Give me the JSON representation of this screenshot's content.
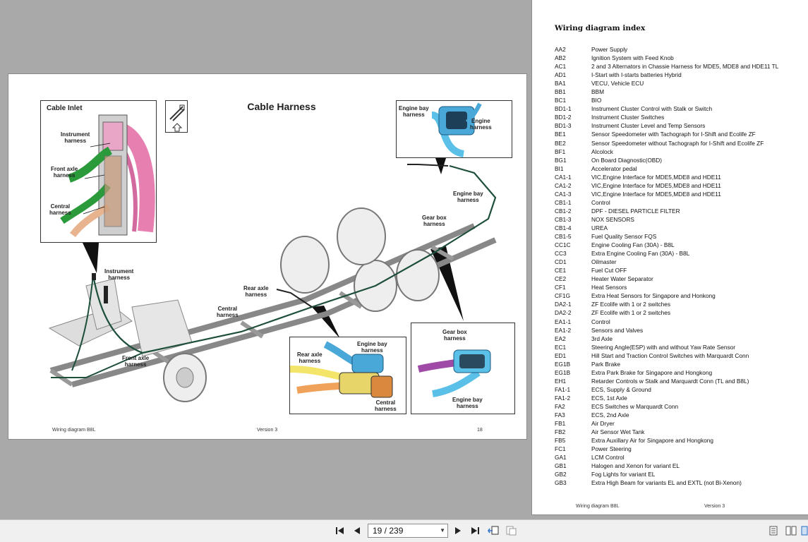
{
  "left_page": {
    "title": "Cable Harness",
    "inset_cable_inlet": "Cable Inlet",
    "labels": {
      "instrument_harness_inset": "Instrument\nharness",
      "front_axle_harness_inset": "Front axle\nharness",
      "central_harness_inset": "Central\nharness",
      "engine_bay_harness_top": "Engine bay\nharness",
      "engine_harness_top": "Engine\nharness",
      "engine_bay_harness_mid": "Engine bay\nharness",
      "gear_box_harness_mid": "Gear box\nharness",
      "instrument_harness_main": "Instrument\nharness",
      "rear_axle_harness_main": "Rear axle\nharness",
      "central_harness_main": "Central\nharness",
      "front_axle_harness_main": "Front axle\nharness",
      "engine_bay_harness_inset2": "Engine bay\nharness",
      "rear_axle_harness_inset2": "Rear axle\nharness",
      "central_harness_inset2": "Central\nharness",
      "gear_box_harness_inset3": "Gear box\nharness",
      "engine_bay_harness_inset3": "Engine bay\nharness"
    },
    "footer_left": "Wiring diagram B8L",
    "footer_center": "Version 3",
    "footer_page": "18"
  },
  "right_page": {
    "title": "Wiring diagram index",
    "rows": [
      {
        "code": "AA2",
        "desc": "Power Supply"
      },
      {
        "code": "AB2",
        "desc": "Ignition System with Feed Knob"
      },
      {
        "code": "AC1",
        "desc": "2 and 3 Alternators in Chassie Harness for MDE5, MDE8 and HDE11 TL"
      },
      {
        "code": "AD1",
        "desc": "I-Start with I-starts batteries Hybrid"
      },
      {
        "code": "BA1",
        "desc": "VECU, Vehicle ECU"
      },
      {
        "code": "BB1",
        "desc": "BBM"
      },
      {
        "code": "BC1",
        "desc": "BIO"
      },
      {
        "code": "BD1-1",
        "desc": "Instrument Cluster Control with Stalk or Switch"
      },
      {
        "code": "BD1-2",
        "desc": "Instrument Cluster Switches"
      },
      {
        "code": "BD1-3",
        "desc": "Instrument Cluster Level and Temp Sensors"
      },
      {
        "code": "BE1",
        "desc": "Sensor Speedometer with Tachograph for I-Shift and Ecolife ZF"
      },
      {
        "code": "BE2",
        "desc": "Sensor Speedometer without Tachograph for I-Shift and Ecolife ZF"
      },
      {
        "code": "BF1",
        "desc": "Alcolock"
      },
      {
        "code": "BG1",
        "desc": "On Board Diagnostic(OBD)"
      },
      {
        "code": "BI1",
        "desc": "Accelerator pedal"
      },
      {
        "code": "CA1-1",
        "desc": "VIC,Engine Interface for MDE5,MDE8 and HDE11"
      },
      {
        "code": "CA1-2",
        "desc": "VIC,Engine Interface for MDE5,MDE8 and HDE11"
      },
      {
        "code": "CA1-3",
        "desc": "VIC,Engine Interface for MDE5,MDE8 and HDE11"
      },
      {
        "code": "CB1-1",
        "desc": "Control"
      },
      {
        "code": "CB1-2",
        "desc": "DPF - DIESEL PARTICLE FILTER"
      },
      {
        "code": "CB1-3",
        "desc": "NOX SENSORS"
      },
      {
        "code": "CB1-4",
        "desc": "UREA"
      },
      {
        "code": "CB1-5",
        "desc": "Fuel Quality Sensor FQS"
      },
      {
        "code": "CC1C",
        "desc": "Engine Cooling Fan (30A) - B8L"
      },
      {
        "code": "CC3",
        "desc": "Extra Engine Cooling Fan (30A) - B8L"
      },
      {
        "code": "CD1",
        "desc": "Oilmaster"
      },
      {
        "code": "CE1",
        "desc": "Fuel Cut OFF"
      },
      {
        "code": "CE2",
        "desc": "Heater Water Separator"
      },
      {
        "code": "CF1",
        "desc": "Heat Sensors"
      },
      {
        "code": "CF1G",
        "desc": "Extra Heat Sensors for Singapore and Honkong"
      },
      {
        "code": "DA2-1",
        "desc": "ZF Ecolife with 1 or 2 switches"
      },
      {
        "code": "DA2-2",
        "desc": "ZF Ecolife with 1 or 2 switches"
      },
      {
        "code": "EA1-1",
        "desc": "Control"
      },
      {
        "code": "EA1-2",
        "desc": "Sensors and Valves"
      },
      {
        "code": "EA2",
        "desc": "3rd Axle"
      },
      {
        "code": "EC1",
        "desc": "Steering Angle(ESP) with and without Yaw Rate Sensor"
      },
      {
        "code": "ED1",
        "desc": "Hill Start and Traction Control Switches with Marquardt Conn"
      },
      {
        "code": "EG1B",
        "desc": "Park Brake"
      },
      {
        "code": "EG1B",
        "desc": "Extra Park Brake for Singapore and Hongkong"
      },
      {
        "code": "EH1",
        "desc": "Retarder Controls w Stalk and Marquardt Conn (TL and B8L)"
      },
      {
        "code": "FA1-1",
        "desc": "ECS, Supply & Ground"
      },
      {
        "code": "FA1-2",
        "desc": "ECS, 1st Axle"
      },
      {
        "code": "FA2",
        "desc": "ECS Switches w Marquardt Conn"
      },
      {
        "code": "FA3",
        "desc": "ECS, 2nd Axle"
      },
      {
        "code": "FB1",
        "desc": "Air Dryer"
      },
      {
        "code": "FB2",
        "desc": "Air Sensor Wet Tank"
      },
      {
        "code": "FB5",
        "desc": "Extra Auxillary Air for Singapore and Hongkong"
      },
      {
        "code": "FC1",
        "desc": "Power Steering"
      },
      {
        "code": "GA1",
        "desc": "LCM Control"
      },
      {
        "code": "GB1",
        "desc": "Halogen and Xenon for variant EL"
      },
      {
        "code": "GB2",
        "desc": "Fog Lights for variant EL"
      },
      {
        "code": "GB3",
        "desc": "Extra High Beam for variants EL and EXTL (not Bi-Xenon)"
      }
    ],
    "footer_left": "Wiring diagram B8L",
    "footer_center": "Version 3"
  },
  "toolbar": {
    "page_indicator": "19 / 239",
    "icons": {
      "first": "first-page-icon",
      "prev": "previous-page-icon",
      "next": "next-page-icon",
      "last": "last-page-icon",
      "back": "go-back-icon",
      "forward": "go-forward-icon",
      "single": "single-page-view-icon",
      "two": "two-page-view-icon",
      "cont": "continuous-view-icon"
    }
  }
}
